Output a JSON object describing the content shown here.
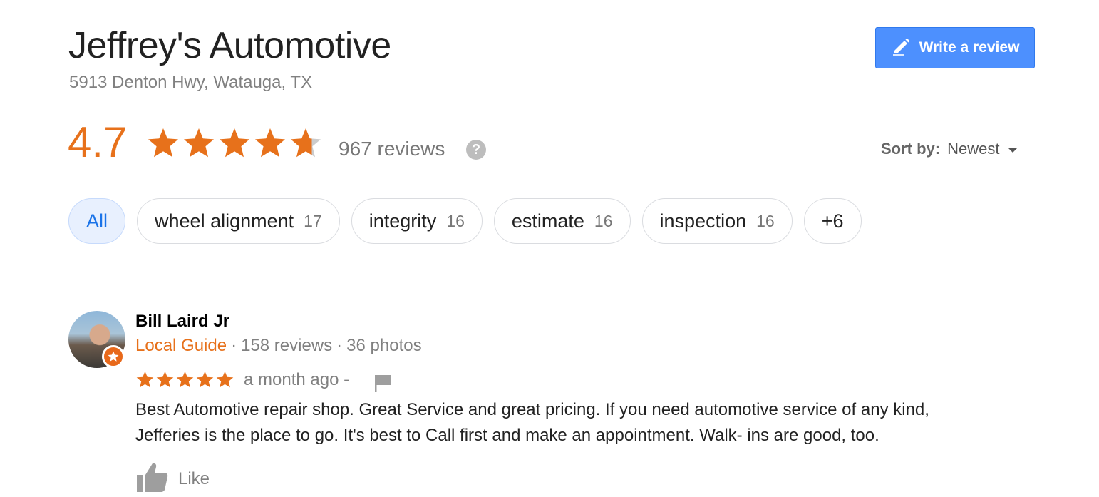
{
  "business": {
    "name": "Jeffrey's Automotive",
    "address": "5913 Denton Hwy, Watauga, TX"
  },
  "write_review": {
    "label": "Write a review",
    "icon": "pencil-icon"
  },
  "rating": {
    "value": "4.7",
    "stars_fraction": 0.94,
    "reviews_label": "967 reviews",
    "help_icon": "?"
  },
  "sort": {
    "label": "Sort by:",
    "value": "Newest"
  },
  "filters": [
    {
      "label": "All",
      "count": ""
    },
    {
      "label": "wheel alignment",
      "count": "17"
    },
    {
      "label": "integrity",
      "count": "16"
    },
    {
      "label": "estimate",
      "count": "16"
    },
    {
      "label": "inspection",
      "count": "16"
    },
    {
      "label": "+6",
      "count": ""
    }
  ],
  "review": {
    "author": "Bill Laird Jr",
    "badge": "Local Guide",
    "reviews_count": "158 reviews",
    "photos_count": "36 photos",
    "separator": "·",
    "rating": 5,
    "time": "a month ago -",
    "text": "Best Automotive repair shop. Great Service and great pricing. If you need automotive service of any kind, Jefferies is the place to go. It's best to Call first and make an appointment. Walk- ins are good, too.",
    "like_label": "Like"
  },
  "colors": {
    "accent_orange": "#e7711b",
    "button_blue": "#4d90fe",
    "chip_active_text": "#1a73e8",
    "star_empty": "#cccccc"
  }
}
